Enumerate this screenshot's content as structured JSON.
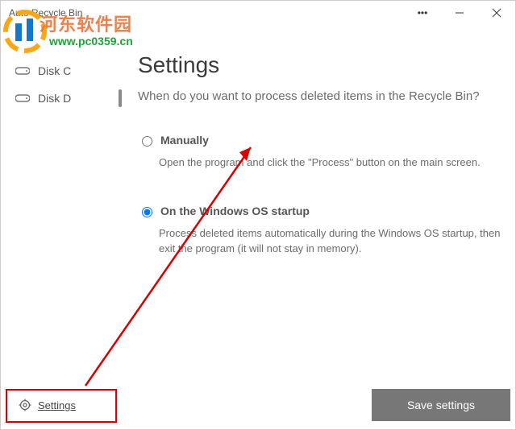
{
  "window": {
    "title": "Auto Recycle Bin"
  },
  "watermark": {
    "text": "河东软件园",
    "url": "www.pc0359.cn"
  },
  "sidebar": {
    "disks": [
      {
        "label": "Disk C"
      },
      {
        "label": "Disk D"
      }
    ],
    "settings_label": "Settings"
  },
  "page": {
    "heading": "Settings",
    "subtitle": "When do you want to process deleted items in the Recycle Bin?",
    "options": [
      {
        "label": "Manually",
        "description": "Open the program and click the \"Process\" button on the main screen."
      },
      {
        "label": "On the Windows OS startup",
        "description": "Process deleted items automatically during the Windows OS startup, then exit the program (it will not stay in memory)."
      }
    ],
    "save_label": "Save settings"
  }
}
